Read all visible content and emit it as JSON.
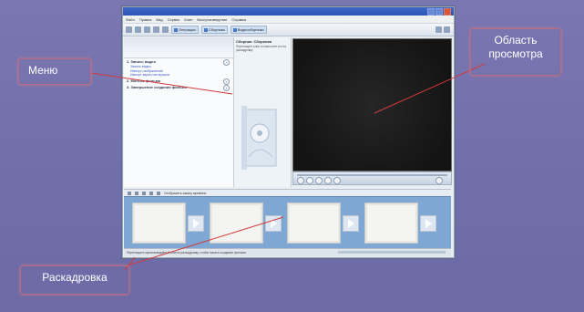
{
  "window": {
    "title": "",
    "menubar": [
      "Файл",
      "Правка",
      "Вид",
      "Сервис",
      "Клип",
      "Воспроизведение",
      "Справка"
    ],
    "toolbar": {
      "btn_tasks": "Операции",
      "btn_collections": "Сборники",
      "btn_collection_name": "Видеосборники"
    }
  },
  "taskpane": {
    "task1": "1. Запись видео",
    "task1_links": [
      "Запись видео",
      "Импорт изображений",
      "Импорт звука или музыки"
    ],
    "task2": "2. Монтаж фильма",
    "task3": "3. Завершение создания фильма"
  },
  "collection": {
    "title": "Сборник: Сборники",
    "desc": "Перетащите клип и поместите его на раскадровку"
  },
  "storyboard": {
    "toolbar_label": "Отобразить шкалу времени",
    "status": "Перетащите мультимедийный клип в раскадровку, чтобы начать создание фильма"
  },
  "callouts": {
    "menu": "Меню",
    "view": "Область просмотра",
    "storyboard": "Раскадровка"
  },
  "colors": {
    "background": "#7472ae",
    "callout_border": "#b86b7e",
    "arrow": "#d23a3a",
    "storyboard": "#7fa7d4",
    "monitor": "#1c1c1c"
  }
}
